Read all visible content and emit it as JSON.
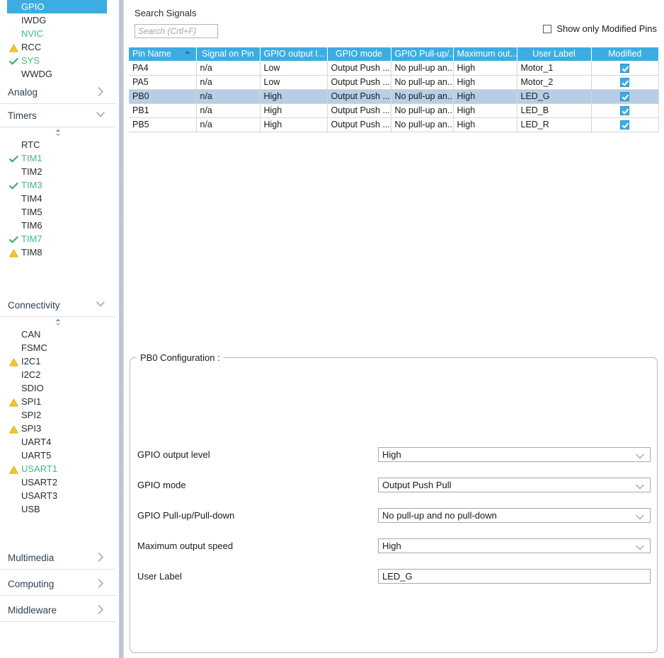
{
  "sidebar": {
    "peripherals": [
      {
        "label": "GPIO",
        "state": "selected",
        "icon": "none"
      },
      {
        "label": "IWDG",
        "state": "normal",
        "icon": "none"
      },
      {
        "label": "NVIC",
        "state": "green",
        "icon": "none"
      },
      {
        "label": "RCC",
        "state": "normal",
        "icon": "warning-icon"
      },
      {
        "label": "SYS",
        "state": "green",
        "icon": "check-icon"
      },
      {
        "label": "WWDG",
        "state": "normal",
        "icon": "none"
      }
    ],
    "sections": [
      {
        "label": "Analog",
        "expanded": false,
        "chevron": "chevron-right-icon"
      },
      {
        "label": "Timers",
        "expanded": true,
        "chevron": "chevron-down-icon"
      },
      {
        "label": "Connectivity",
        "expanded": true,
        "chevron": "chevron-down-icon"
      },
      {
        "label": "Multimedia",
        "expanded": false,
        "chevron": "chevron-right-icon"
      },
      {
        "label": "Computing",
        "expanded": false,
        "chevron": "chevron-right-icon"
      },
      {
        "label": "Middleware",
        "expanded": false,
        "chevron": "chevron-right-icon"
      }
    ],
    "timers": [
      {
        "label": "RTC",
        "state": "normal",
        "icon": "none"
      },
      {
        "label": "TIM1",
        "state": "green",
        "icon": "check-icon"
      },
      {
        "label": "TIM2",
        "state": "normal",
        "icon": "none"
      },
      {
        "label": "TIM3",
        "state": "green",
        "icon": "check-icon"
      },
      {
        "label": "TIM4",
        "state": "normal",
        "icon": "none"
      },
      {
        "label": "TIM5",
        "state": "normal",
        "icon": "none"
      },
      {
        "label": "TIM6",
        "state": "normal",
        "icon": "none"
      },
      {
        "label": "TIM7",
        "state": "green",
        "icon": "check-icon"
      },
      {
        "label": "TIM8",
        "state": "normal",
        "icon": "warning-icon"
      }
    ],
    "connectivity": [
      {
        "label": "CAN",
        "state": "normal",
        "icon": "none"
      },
      {
        "label": "FSMC",
        "state": "normal",
        "icon": "none"
      },
      {
        "label": "I2C1",
        "state": "normal",
        "icon": "warning-icon"
      },
      {
        "label": "I2C2",
        "state": "normal",
        "icon": "none"
      },
      {
        "label": "SDIO",
        "state": "normal",
        "icon": "none"
      },
      {
        "label": "SPI1",
        "state": "normal",
        "icon": "warning-icon"
      },
      {
        "label": "SPI2",
        "state": "normal",
        "icon": "none"
      },
      {
        "label": "SPI3",
        "state": "normal",
        "icon": "warning-icon"
      },
      {
        "label": "UART4",
        "state": "normal",
        "icon": "none"
      },
      {
        "label": "UART5",
        "state": "normal",
        "icon": "none"
      },
      {
        "label": "USART1",
        "state": "green",
        "icon": "warning-icon"
      },
      {
        "label": "USART2",
        "state": "normal",
        "icon": "none"
      },
      {
        "label": "USART3",
        "state": "normal",
        "icon": "none"
      },
      {
        "label": "USB",
        "state": "normal",
        "icon": "none"
      }
    ]
  },
  "search": {
    "label": "Search Signals",
    "placeholder": "Search (Crtl+F)",
    "value": ""
  },
  "filter": {
    "modified_pins_label": "Show only Modified Pins",
    "modified_pins_checked": false
  },
  "table": {
    "columns": [
      "Pin Name",
      "Signal on Pin",
      "GPIO output l...",
      "GPIO mode",
      "GPIO Pull-up/...",
      "Maximum out...",
      "User Label",
      "Modified"
    ],
    "sorted_column": "Pin Name",
    "sort_direction": "ascending",
    "rows": [
      {
        "pin": "PA4",
        "signal": "n/a",
        "output_level": "Low",
        "mode": "Output Push ...",
        "pull": "No pull-up an...",
        "speed": "High",
        "label": "Motor_1",
        "modified": true,
        "selected": false
      },
      {
        "pin": "PA5",
        "signal": "n/a",
        "output_level": "Low",
        "mode": "Output Push ...",
        "pull": "No pull-up an...",
        "speed": "High",
        "label": "Motor_2",
        "modified": true,
        "selected": false
      },
      {
        "pin": "PB0",
        "signal": "n/a",
        "output_level": "High",
        "mode": "Output Push ...",
        "pull": "No pull-up an...",
        "speed": "High",
        "label": "LED_G",
        "modified": true,
        "selected": true
      },
      {
        "pin": "PB1",
        "signal": "n/a",
        "output_level": "High",
        "mode": "Output Push ...",
        "pull": "No pull-up an...",
        "speed": "High",
        "label": "LED_B",
        "modified": true,
        "selected": false
      },
      {
        "pin": "PB5",
        "signal": "n/a",
        "output_level": "High",
        "mode": "Output Push ...",
        "pull": "No pull-up an...",
        "speed": "High",
        "label": "LED_R",
        "modified": true,
        "selected": false
      }
    ]
  },
  "config": {
    "title": "PB0 Configuration :",
    "fields": [
      {
        "label": "GPIO output level",
        "value": "High",
        "type": "select"
      },
      {
        "label": "GPIO mode",
        "value": "Output Push Pull",
        "type": "select"
      },
      {
        "label": "GPIO Pull-up/Pull-down",
        "value": "No pull-up and no pull-down",
        "type": "select"
      },
      {
        "label": "Maximum output speed",
        "value": "High",
        "type": "select"
      },
      {
        "label": "User Label",
        "value": "LED_G",
        "type": "text"
      }
    ]
  },
  "colors": {
    "accent_blue": "#3bade3",
    "selection_row": "#b7cfe6",
    "green_text": "#3fb984",
    "warning_yellow": "#f5c330",
    "section_text": "#2d3e57"
  }
}
